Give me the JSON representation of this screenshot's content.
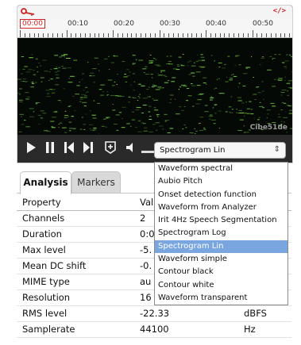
{
  "timeline": {
    "current": "00:00",
    "labels": [
      "00:10",
      "00:20",
      "00:30",
      "00:40",
      "00:50"
    ]
  },
  "icons": {
    "key": "key-icon",
    "code": "code-icon",
    "play": "play-icon",
    "pause": "pause-icon",
    "prev": "skip-back-icon",
    "next": "skip-forward-icon",
    "add_marker": "add-marker-icon",
    "volume": "volume-icon"
  },
  "code_label": "</>",
  "watermark": "Cibe51de",
  "view_select": {
    "selected": "Spectrogram Lin",
    "arrow": "⇕"
  },
  "dropdown_options": [
    "Waveform spectral",
    "Aubio Pitch",
    "Onset detection function",
    "Waveform from Analyzer",
    "Irit 4Hz Speech Segmentation",
    "Spectrogram Log",
    "Spectrogram Lin",
    "Waveform simple",
    "Contour black",
    "Contour white",
    "Waveform transparent"
  ],
  "selected_option_index": 6,
  "tabs": {
    "analysis": "Analysis",
    "markers": "Markers"
  },
  "table": {
    "header": {
      "property": "Property",
      "value": "Val",
      "unit": ""
    },
    "rows": [
      {
        "property": "Channels",
        "value": "2",
        "unit": ""
      },
      {
        "property": "Duration",
        "value": "0:0",
        "unit": ""
      },
      {
        "property": "Max level",
        "value": "-5.",
        "unit": ""
      },
      {
        "property": "Mean DC shift",
        "value": "-0.",
        "unit": ""
      },
      {
        "property": "MIME type",
        "value": "au",
        "unit": ""
      },
      {
        "property": "Resolution",
        "value": "16",
        "unit": ""
      },
      {
        "property": "RMS level",
        "value": "-22.33",
        "unit": "dBFS"
      },
      {
        "property": "Samplerate",
        "value": "44100",
        "unit": "Hz"
      }
    ]
  },
  "colors": {
    "accent_red": "#cc2222",
    "selected_option": "#7aa6e0",
    "spectrogram_green": "#7fdc4a"
  }
}
